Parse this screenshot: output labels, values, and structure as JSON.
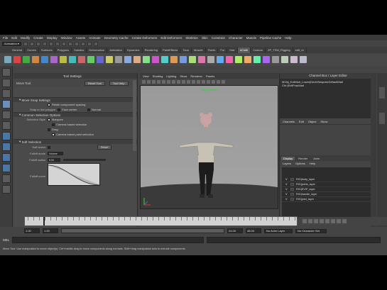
{
  "menubar": [
    "File",
    "Edit",
    "Modify",
    "Create",
    "Display",
    "Window",
    "Assets",
    "Animate",
    "Geometry Cache",
    "Create Deformers",
    "Edit Deformers",
    "Skeleton",
    "Skin",
    "Constrain",
    "Character",
    "Muscle",
    "Pipeline Cache",
    "Help"
  ],
  "status": {
    "mode": "Animation"
  },
  "shelf_tabs": [
    "General",
    "Curves",
    "Surfaces",
    "Polygons",
    "Subdivs",
    "Deformation",
    "Animation",
    "Dynamics",
    "Rendering",
    "PaintEffects",
    "Toon",
    "Muscle",
    "Fluids",
    "Fur",
    "Hair",
    "nCloth",
    "Custom",
    "ZP_TSM_Rigging",
    "edit_re"
  ],
  "active_shelf_tab": "nCloth",
  "tool_settings": {
    "title": "Tool Settings",
    "tool_name": "Move Tool",
    "reset_button": "Reset Tool",
    "help_button": "Tool Help",
    "snap_frame": "Move Snap Settings",
    "retain_spacing": "Retain component spacing",
    "snap_live": "Snap to live polygon",
    "face_center": "Face center",
    "normal": "Normal",
    "common_frame": "Common Selection Options",
    "selection_style": "Selection Style",
    "marquee": "Marquee",
    "camera_selection": "Camera based selection",
    "drag": "Drag",
    "camera_paint": "Camera based paint selection",
    "soft_frame": "Soft Selection",
    "soft_select": "Soft select",
    "reset_soft": "Reset",
    "falloff_mode": "Falloff mode",
    "falloff_value": "Volume",
    "falloff_radius": "Falloff radius",
    "radius_value": "5.00",
    "falloff_curve": "Falloff curve"
  },
  "viewport": {
    "menus": [
      "View",
      "Shading",
      "Lighting",
      "Show",
      "Renderer",
      "Panels"
    ],
    "camera_label": "Right Profile"
  },
  "channel_box": {
    "title": "Channel Box / Layer Editor",
    "text_lines": [
      "MObj_EvilMarl_Lower|Devil:BespokeDefaultMarl",
      "Chr:|EvilFrauMarl"
    ],
    "menus": [
      "Channels",
      "Edit",
      "Object",
      "Show"
    ],
    "layer_tabs": [
      "Display",
      "Render",
      "Anim"
    ],
    "layer_menus": [
      "Layers",
      "Options",
      "Help"
    ],
    "layers": [
      {
        "vis": "V",
        "name": "RIG|body_layer"
      },
      {
        "vis": "V",
        "name": "RIG|joints_layer"
      },
      {
        "vis": "V",
        "name": "RIG|EVIP_layer"
      },
      {
        "vis": "V",
        "name": "RIG|handle_layer"
      },
      {
        "vis": "V",
        "name": "RIG|joint_layer"
      }
    ]
  },
  "time": {
    "start": "1.00",
    "end": "24.00",
    "range_start": "1.00",
    "range_end": "48.00",
    "current": "1.00",
    "anim_layer": "No Anim Layer",
    "character_set": "No Character Set"
  },
  "command_line": {
    "label": "MEL"
  },
  "help_line": "Move Tool: Use manipulator to move object(s). Ctrl+middle-drag to move components along normals. Shift+drag manipulator axis to extrude components."
}
